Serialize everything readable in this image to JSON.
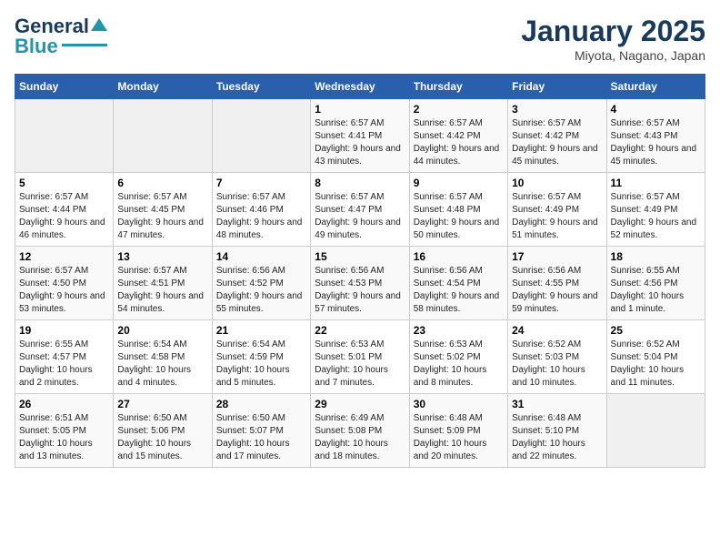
{
  "header": {
    "logo_general": "General",
    "logo_blue": "Blue",
    "month": "January 2025",
    "location": "Miyota, Nagano, Japan"
  },
  "weekdays": [
    "Sunday",
    "Monday",
    "Tuesday",
    "Wednesday",
    "Thursday",
    "Friday",
    "Saturday"
  ],
  "weeks": [
    [
      {
        "day": "",
        "info": ""
      },
      {
        "day": "",
        "info": ""
      },
      {
        "day": "",
        "info": ""
      },
      {
        "day": "1",
        "info": "Sunrise: 6:57 AM\nSunset: 4:41 PM\nDaylight: 9 hours and 43 minutes."
      },
      {
        "day": "2",
        "info": "Sunrise: 6:57 AM\nSunset: 4:42 PM\nDaylight: 9 hours and 44 minutes."
      },
      {
        "day": "3",
        "info": "Sunrise: 6:57 AM\nSunset: 4:42 PM\nDaylight: 9 hours and 45 minutes."
      },
      {
        "day": "4",
        "info": "Sunrise: 6:57 AM\nSunset: 4:43 PM\nDaylight: 9 hours and 45 minutes."
      }
    ],
    [
      {
        "day": "5",
        "info": "Sunrise: 6:57 AM\nSunset: 4:44 PM\nDaylight: 9 hours and 46 minutes."
      },
      {
        "day": "6",
        "info": "Sunrise: 6:57 AM\nSunset: 4:45 PM\nDaylight: 9 hours and 47 minutes."
      },
      {
        "day": "7",
        "info": "Sunrise: 6:57 AM\nSunset: 4:46 PM\nDaylight: 9 hours and 48 minutes."
      },
      {
        "day": "8",
        "info": "Sunrise: 6:57 AM\nSunset: 4:47 PM\nDaylight: 9 hours and 49 minutes."
      },
      {
        "day": "9",
        "info": "Sunrise: 6:57 AM\nSunset: 4:48 PM\nDaylight: 9 hours and 50 minutes."
      },
      {
        "day": "10",
        "info": "Sunrise: 6:57 AM\nSunset: 4:49 PM\nDaylight: 9 hours and 51 minutes."
      },
      {
        "day": "11",
        "info": "Sunrise: 6:57 AM\nSunset: 4:49 PM\nDaylight: 9 hours and 52 minutes."
      }
    ],
    [
      {
        "day": "12",
        "info": "Sunrise: 6:57 AM\nSunset: 4:50 PM\nDaylight: 9 hours and 53 minutes."
      },
      {
        "day": "13",
        "info": "Sunrise: 6:57 AM\nSunset: 4:51 PM\nDaylight: 9 hours and 54 minutes."
      },
      {
        "day": "14",
        "info": "Sunrise: 6:56 AM\nSunset: 4:52 PM\nDaylight: 9 hours and 55 minutes."
      },
      {
        "day": "15",
        "info": "Sunrise: 6:56 AM\nSunset: 4:53 PM\nDaylight: 9 hours and 57 minutes."
      },
      {
        "day": "16",
        "info": "Sunrise: 6:56 AM\nSunset: 4:54 PM\nDaylight: 9 hours and 58 minutes."
      },
      {
        "day": "17",
        "info": "Sunrise: 6:56 AM\nSunset: 4:55 PM\nDaylight: 9 hours and 59 minutes."
      },
      {
        "day": "18",
        "info": "Sunrise: 6:55 AM\nSunset: 4:56 PM\nDaylight: 10 hours and 1 minute."
      }
    ],
    [
      {
        "day": "19",
        "info": "Sunrise: 6:55 AM\nSunset: 4:57 PM\nDaylight: 10 hours and 2 minutes."
      },
      {
        "day": "20",
        "info": "Sunrise: 6:54 AM\nSunset: 4:58 PM\nDaylight: 10 hours and 4 minutes."
      },
      {
        "day": "21",
        "info": "Sunrise: 6:54 AM\nSunset: 4:59 PM\nDaylight: 10 hours and 5 minutes."
      },
      {
        "day": "22",
        "info": "Sunrise: 6:53 AM\nSunset: 5:01 PM\nDaylight: 10 hours and 7 minutes."
      },
      {
        "day": "23",
        "info": "Sunrise: 6:53 AM\nSunset: 5:02 PM\nDaylight: 10 hours and 8 minutes."
      },
      {
        "day": "24",
        "info": "Sunrise: 6:52 AM\nSunset: 5:03 PM\nDaylight: 10 hours and 10 minutes."
      },
      {
        "day": "25",
        "info": "Sunrise: 6:52 AM\nSunset: 5:04 PM\nDaylight: 10 hours and 11 minutes."
      }
    ],
    [
      {
        "day": "26",
        "info": "Sunrise: 6:51 AM\nSunset: 5:05 PM\nDaylight: 10 hours and 13 minutes."
      },
      {
        "day": "27",
        "info": "Sunrise: 6:50 AM\nSunset: 5:06 PM\nDaylight: 10 hours and 15 minutes."
      },
      {
        "day": "28",
        "info": "Sunrise: 6:50 AM\nSunset: 5:07 PM\nDaylight: 10 hours and 17 minutes."
      },
      {
        "day": "29",
        "info": "Sunrise: 6:49 AM\nSunset: 5:08 PM\nDaylight: 10 hours and 18 minutes."
      },
      {
        "day": "30",
        "info": "Sunrise: 6:48 AM\nSunset: 5:09 PM\nDaylight: 10 hours and 20 minutes."
      },
      {
        "day": "31",
        "info": "Sunrise: 6:48 AM\nSunset: 5:10 PM\nDaylight: 10 hours and 22 minutes."
      },
      {
        "day": "",
        "info": ""
      }
    ]
  ]
}
